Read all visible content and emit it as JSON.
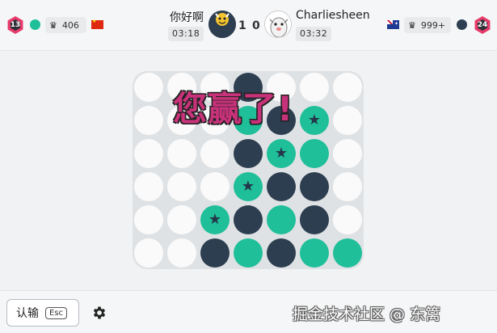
{
  "header": {
    "left_player": {
      "level": "13",
      "rating": "406",
      "name": "你好啊",
      "timer": "03:18",
      "flag": "china-flag",
      "color": "#1fbf99"
    },
    "right_player": {
      "level": "24",
      "rating": "999+",
      "name": "Charliesheen",
      "timer": "03:32",
      "flag": "australia-flag",
      "color": "#2d3e50"
    },
    "score_left": "1",
    "score_right": "0"
  },
  "board": {
    "rows": 6,
    "cols": 7,
    "cells": [
      [
        "empty",
        "empty",
        "empty",
        "dark",
        "empty",
        "empty",
        "empty"
      ],
      [
        "empty",
        "empty",
        "empty",
        "teal",
        "dark",
        "teal*",
        "empty"
      ],
      [
        "empty",
        "empty",
        "empty",
        "dark",
        "teal*",
        "teal",
        "empty"
      ],
      [
        "empty",
        "empty",
        "empty",
        "teal*",
        "dark",
        "dark",
        "empty"
      ],
      [
        "empty",
        "empty",
        "teal*",
        "dark",
        "teal",
        "dark",
        "empty"
      ],
      [
        "empty",
        "empty",
        "dark",
        "teal",
        "dark",
        "teal",
        "teal"
      ]
    ],
    "colors": {
      "dark": "#2d3e50",
      "teal": "#1fbf99",
      "empty": "#fafafa",
      "board": "#dfe2e5"
    },
    "win_message": "您赢了!"
  },
  "footer": {
    "resign_label": "认输",
    "resign_shortcut": "Esc",
    "settings_icon": "gear-icon",
    "watermark": "掘金技术社区 @ 东篱"
  }
}
